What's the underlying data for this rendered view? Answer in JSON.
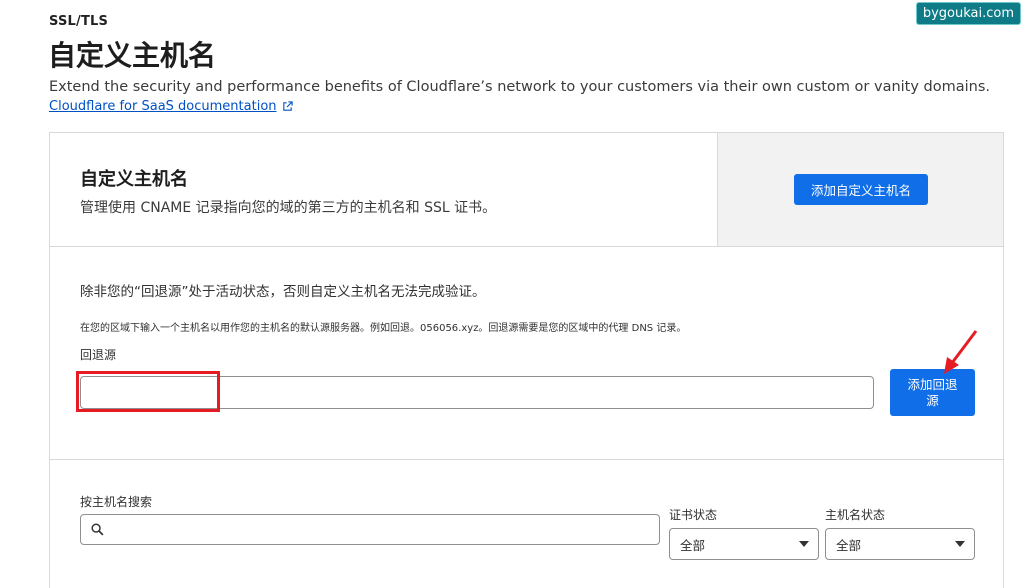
{
  "header": {
    "breadcrumb": "SSL/TLS",
    "title": "自定义主机名",
    "description": "Extend the security and performance benefits of Cloudflare’s network to your customers via their own custom or vanity domains.",
    "doc_link": "Cloudflare for SaaS documentation",
    "external_link_icon": "external-link-icon"
  },
  "watermark": "bygoukai.com",
  "custom_hostnames_card": {
    "title": "自定义主机名",
    "description": "管理使用 CNAME 记录指向您的域的第三方的主机名和 SSL 证书。",
    "add_button": "添加自定义主机名"
  },
  "fallback_origin": {
    "notice": "除非您的“回退源”处于活动状态，否则自定义主机名无法完成验证。",
    "hint": "在您的区域下输入一个主机名以用作您的主机名的默认源服务器。例如回退。056056.xyz。回退源需要是您的区域中的代理 DNS 记录。",
    "label": "回退源",
    "input_value": "",
    "add_button": "添加回退源",
    "highlight_color": "#e51c23"
  },
  "search": {
    "label": "按主机名搜索",
    "placeholder": "",
    "icon": "search-icon",
    "cert_status_label": "证书状态",
    "cert_status_value": "全部",
    "hostname_status_label": "主机名状态",
    "hostname_status_value": "全部"
  },
  "colors": {
    "primary_button": "#0f6ee8",
    "link": "#0051c3",
    "annotation": "#e51c23"
  }
}
